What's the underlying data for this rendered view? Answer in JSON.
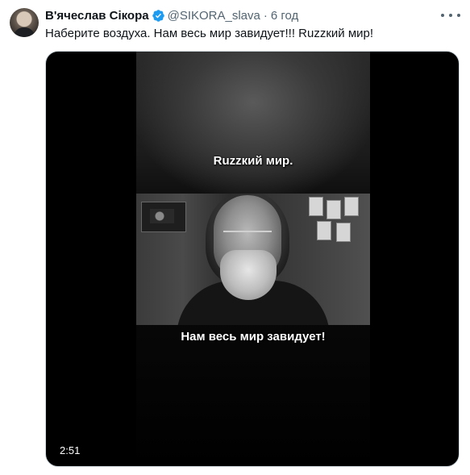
{
  "tweet": {
    "author_name": "В'ячеслав Сікора",
    "verified_icon": "verified-badge-icon",
    "handle": "@SIKORA_slava",
    "separator": "·",
    "time": "6 год",
    "more_icon": "more-options-icon",
    "text": "Наберите воздуха. Нам весь мир завидует!!! Ruzzкий мир!"
  },
  "video": {
    "caption_top": "Ruzzкий мир.",
    "caption_bottom": "Нам весь мир завидует!",
    "duration": "2:51"
  },
  "colors": {
    "verified_blue": "#1d9bf0",
    "secondary_text": "#536471",
    "primary_text": "#0f1419"
  }
}
